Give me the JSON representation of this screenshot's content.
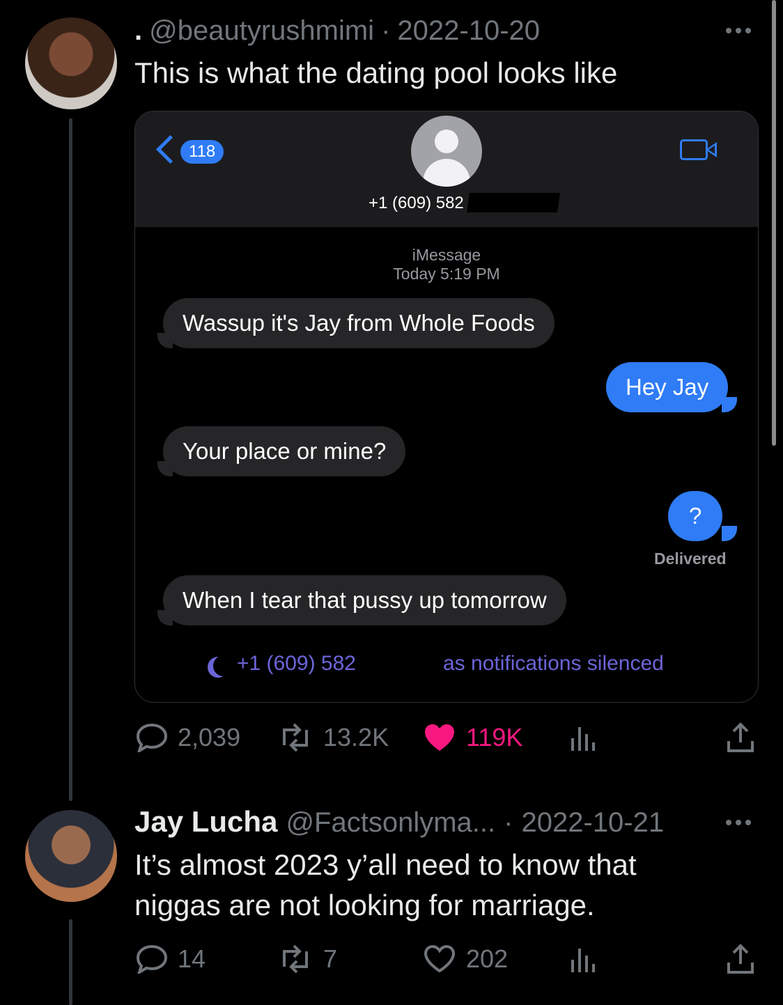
{
  "tweets": [
    {
      "display_name": ".",
      "handle": "@beautyrushmimi",
      "separator": "·",
      "date": "2022-10-20",
      "text": "This is what the dating pool looks like",
      "stats": {
        "replies": "2,039",
        "retweets": "13.2K",
        "likes": "119K"
      }
    },
    {
      "display_name": "Jay Lucha",
      "handle": "@Factsonlyma...",
      "separator": "·",
      "date": "2022-10-21",
      "text_line1": "It’s almost 2023 y’all need to know that",
      "text_line2": "niggas are not looking for marriage.",
      "stats": {
        "replies": "14",
        "retweets": "7",
        "likes": "202"
      }
    }
  ],
  "imessage": {
    "back_count": "118",
    "contact_number": "+1 (609) 582",
    "service_label": "iMessage",
    "timestamp": "Today 5:19 PM",
    "messages": [
      {
        "direction": "in",
        "text": "Wassup it's Jay from Whole Foods"
      },
      {
        "direction": "out",
        "text": "Hey Jay"
      },
      {
        "direction": "in",
        "text": "Your place or mine?"
      },
      {
        "direction": "out",
        "text": "?"
      },
      {
        "direction": "in",
        "text": "When I tear that pussy up tomorrow"
      }
    ],
    "delivered_label": "Delivered",
    "silenced_number": "+1 (609) 582",
    "silenced_suffix": "as notifications silenced"
  },
  "colors": {
    "imessage_blue": "#2f7cf6",
    "like_pink": "#f91880",
    "muted": "#71767b",
    "focus_purple": "#6b65d8"
  }
}
